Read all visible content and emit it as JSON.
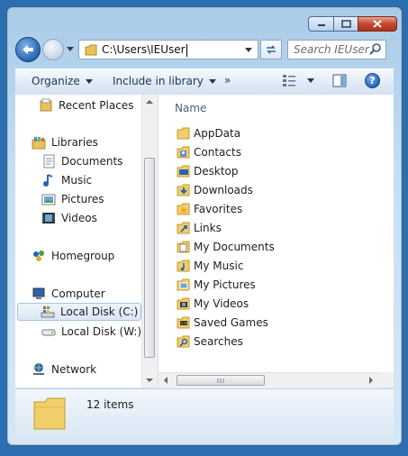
{
  "window": {
    "caption_buttons": {
      "minimize_icon": "minimize-icon",
      "maximize_icon": "maximize-icon",
      "close_icon": "close-icon"
    }
  },
  "navbar": {
    "address": "C:\\Users\\IEUser",
    "search_placeholder": "Search IEUser"
  },
  "commands": {
    "organize": "Organize",
    "include_in_library": "Include in library",
    "more": "»"
  },
  "nav_pane": {
    "items": [
      {
        "label": "Recent Places",
        "icon": "recent-places-icon"
      },
      {
        "label": "Libraries",
        "icon": "libraries-icon"
      },
      {
        "label": "Documents",
        "icon": "documents-icon"
      },
      {
        "label": "Music",
        "icon": "music-icon"
      },
      {
        "label": "Pictures",
        "icon": "pictures-icon"
      },
      {
        "label": "Videos",
        "icon": "videos-icon"
      },
      {
        "label": "Homegroup",
        "icon": "homegroup-icon"
      },
      {
        "label": "Computer",
        "icon": "computer-icon"
      },
      {
        "label": "Local Disk (C:)",
        "icon": "system-drive-icon"
      },
      {
        "label": "Local Disk (W:)",
        "icon": "drive-icon"
      },
      {
        "label": "Network",
        "icon": "network-icon"
      }
    ],
    "selected": "Local Disk (C:)"
  },
  "content": {
    "column_header": "Name",
    "files": [
      {
        "name": "AppData",
        "icon": "folder-icon"
      },
      {
        "name": "Contacts",
        "icon": "contacts-folder-icon"
      },
      {
        "name": "Desktop",
        "icon": "desktop-folder-icon"
      },
      {
        "name": "Downloads",
        "icon": "downloads-folder-icon"
      },
      {
        "name": "Favorites",
        "icon": "favorites-folder-icon"
      },
      {
        "name": "Links",
        "icon": "links-folder-icon"
      },
      {
        "name": "My Documents",
        "icon": "documents-folder-icon"
      },
      {
        "name": "My Music",
        "icon": "music-folder-icon"
      },
      {
        "name": "My Pictures",
        "icon": "pictures-folder-icon"
      },
      {
        "name": "My Videos",
        "icon": "videos-folder-icon"
      },
      {
        "name": "Saved Games",
        "icon": "saved-games-folder-icon"
      },
      {
        "name": "Searches",
        "icon": "searches-folder-icon"
      }
    ]
  },
  "details": {
    "item_count": "12 items"
  },
  "colors": {
    "frame": "#c6dff3",
    "accent": "#2a64b4",
    "close": "#c44a31",
    "selection": "#dbe7f5"
  }
}
